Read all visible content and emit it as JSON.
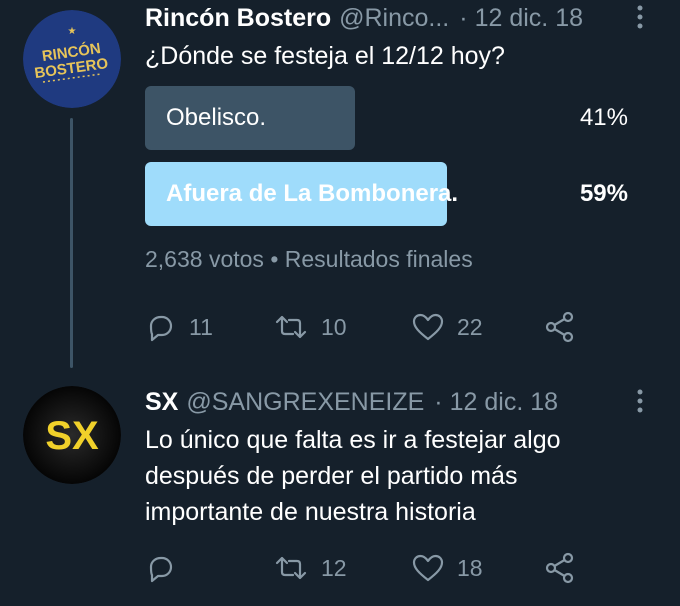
{
  "tweets": [
    {
      "name": "Rincón Bostero",
      "handle": "@Rinco...",
      "date": "12 dic. 18",
      "avatar_text": [
        "RINCÓN",
        "BOSTERO"
      ],
      "text": "¿Dónde se festeja el 12/12 hoy?",
      "poll": {
        "options": [
          {
            "label": "Obelisco.",
            "percent": "41%",
            "value": 41,
            "winner": false
          },
          {
            "label": "Afuera de La Bombonera.",
            "percent": "59%",
            "value": 59,
            "winner": true
          }
        ],
        "votes": "2,638 votos",
        "status": "Resultados finales"
      },
      "actions": {
        "replies": "11",
        "retweets": "10",
        "likes": "22"
      }
    },
    {
      "name": "SX",
      "handle": "@SANGREXENEIZE",
      "date": "12 dic. 18",
      "avatar_text": "SX",
      "text_lines": [
        "Lo único que falta es ir a festejar algo",
        "después de perder el partido más",
        "importante de nuestra historia"
      ],
      "actions": {
        "replies": "",
        "retweets": "12",
        "likes": "18"
      }
    }
  ],
  "colors": {
    "background": "#15202b",
    "muted": "#8899a6",
    "poll_bar": "#3d5466",
    "poll_winner": "#9fdcfb",
    "avatar1_bg": "#1f3a80",
    "avatar1_text": "#e6c45a",
    "avatar2_text": "#f1d12a"
  },
  "icons": [
    "reply-icon",
    "retweet-icon",
    "like-icon",
    "share-icon",
    "more-icon"
  ]
}
